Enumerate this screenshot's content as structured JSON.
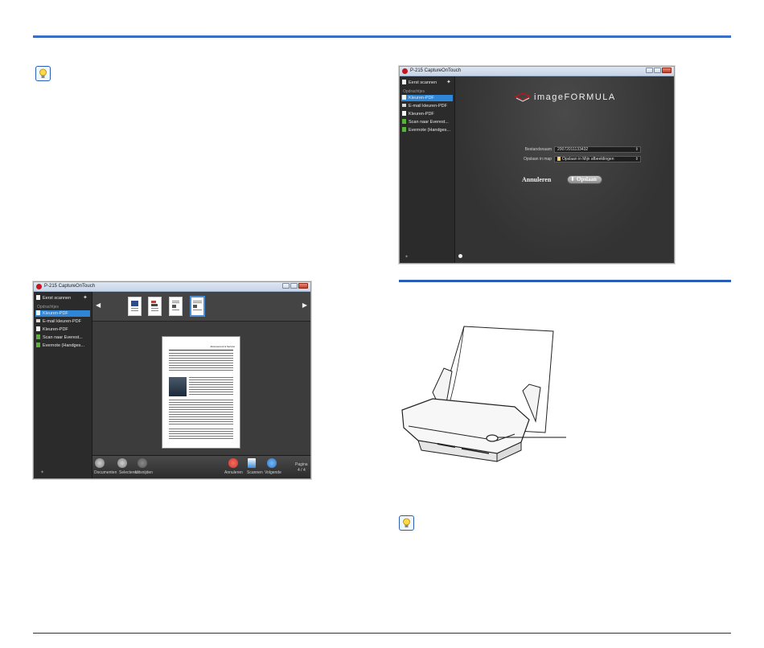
{
  "window_title": "P-215 CaptureOnTouch",
  "sidebar": {
    "quick_scan": "Eerst scannen",
    "section_label": "Opdrachtjes",
    "items": [
      {
        "label": "Kleuren-PDF",
        "icon": "pdf-icon"
      },
      {
        "label": "E-mail kleuren-PDF",
        "icon": "mail-icon"
      },
      {
        "label": "Kleuren-PDF",
        "icon": "pdf-icon"
      },
      {
        "label": "Scan naar Everest...",
        "icon": "evernote-icon"
      },
      {
        "label": "Evernote (Handges...",
        "icon": "evernote-icon"
      }
    ]
  },
  "save_screen": {
    "logo": "imageFORMULA",
    "filename_label": "Bestandsnaam",
    "filename_value": "20072011133432",
    "saveto_label": "Opslaan in map",
    "saveto_value": "Opslaan in Mijn afbeeldingen",
    "cancel_label": "Annuleren",
    "save_label": "Opslaan"
  },
  "preview_screen": {
    "doc_heading": "Abonnement & Service",
    "tools_left": [
      {
        "label": "Documenten",
        "icon": "rotate-icon"
      },
      {
        "label": "Selecteren",
        "icon": "select-icon"
      },
      {
        "label": "Uitsnijden",
        "icon": "crop-icon"
      }
    ],
    "tools_right": [
      {
        "label": "Annuleren",
        "icon": "cancel-icon",
        "color": "#d9302a"
      },
      {
        "label": "Scannen",
        "icon": "scan-icon",
        "color": "#3a8ad8"
      },
      {
        "label": "Volgende",
        "icon": "next-icon",
        "color": "#2a78d0"
      }
    ],
    "page_label": "Pagina",
    "page_value": "4 / 4"
  },
  "colors": {
    "accent": "#2a5cb8",
    "selection": "#2f86d6"
  }
}
